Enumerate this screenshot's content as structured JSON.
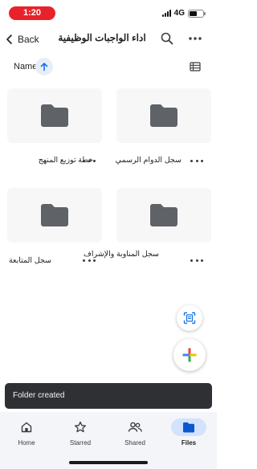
{
  "status_bar": {
    "time": "1:20",
    "network": "4G",
    "battery_level": 0.55
  },
  "appbar": {
    "back_label": "Back",
    "folder_title": "اداء الواجبات الوظيفية"
  },
  "sort": {
    "label": "Name",
    "direction": "ascending"
  },
  "folders": [
    {
      "name": "سجل الدوام الرسمي"
    },
    {
      "name": "خطة توزيع المنهج"
    },
    {
      "name": "سجل المناوبة والإشراف"
    },
    {
      "name": "سجل المتابعة"
    }
  ],
  "snackbar": {
    "text": "Folder created"
  },
  "bottom_nav": [
    {
      "label": "Home",
      "icon": "home-icon",
      "active": false
    },
    {
      "label": "Starred",
      "icon": "star-icon",
      "active": false
    },
    {
      "label": "Shared",
      "icon": "shared-icon",
      "active": false
    },
    {
      "label": "Files",
      "icon": "folder-icon",
      "active": true
    }
  ],
  "colors": {
    "accent": "#1a73e8",
    "folder": "#5f6368",
    "snackbar": "#2f3033",
    "active_pill": "#d3e3fd"
  }
}
